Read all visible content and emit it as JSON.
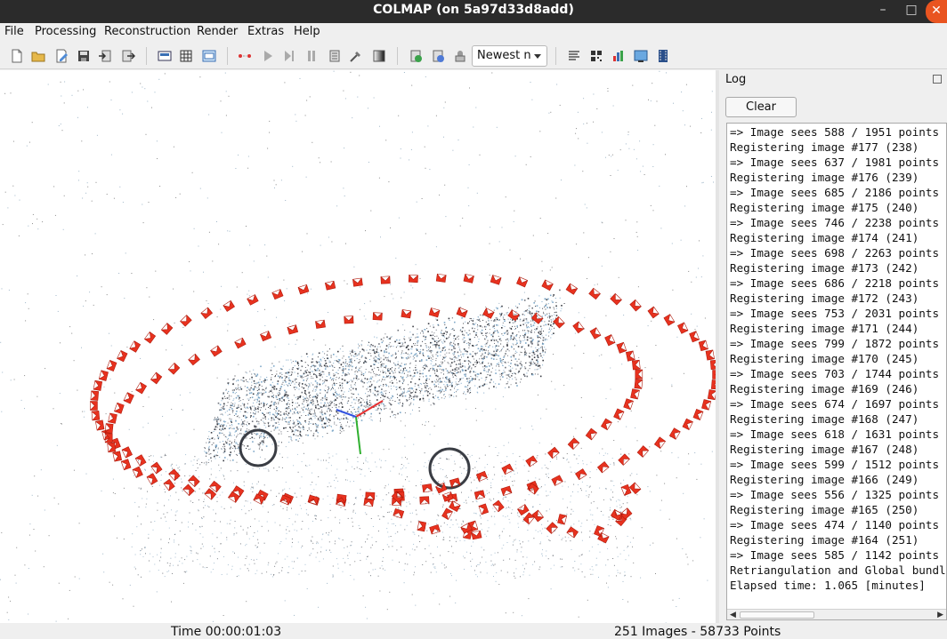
{
  "window": {
    "title": "COLMAP (on 5a97d33d8add)",
    "minimize": "–",
    "maximize": "□",
    "close": "✕"
  },
  "menu": [
    "File",
    "Processing",
    "Reconstruction",
    "Render",
    "Extras",
    "Help"
  ],
  "toolbar": {
    "icons": [
      "new-project-icon",
      "open-project-icon",
      "edit-project-icon",
      "save-project-icon",
      "import-model-icon",
      "export-model-icon",
      "feature-extraction-icon",
      "feature-matching-icon",
      "database-management-icon",
      "reconstruction-start-icon",
      "reconstruction-step-icon",
      "reconstruction-pause-icon",
      "reconstruction-normalize-icon",
      "reconstruction-options-icon",
      "bundle-adjustment-icon",
      "dense-reconstruction-icon",
      "render-toggle-icon",
      "render-reset-icon",
      "render-options-icon",
      "model-statistics-icon",
      "match-matrix-icon",
      "log-icon",
      "grab-image-icon",
      "grab-movie-icon"
    ],
    "model_select": "Newest n"
  },
  "log": {
    "title": "Log",
    "clear_label": "Clear",
    "lines": [
      "=> Image sees 588 / 1951 points",
      "Registering image #177 (238)",
      "=> Image sees 637 / 1981 points",
      "Registering image #176 (239)",
      "=> Image sees 685 / 2186 points",
      "Registering image #175 (240)",
      "=> Image sees 746 / 2238 points",
      "Registering image #174 (241)",
      "=> Image sees 698 / 2263 points",
      "Registering image #173 (242)",
      "=> Image sees 686 / 2218 points",
      "Registering image #172 (243)",
      "=> Image sees 753 / 2031 points",
      "Registering image #171 (244)",
      "=> Image sees 799 / 1872 points",
      "Registering image #170 (245)",
      "=> Image sees 703 / 1744 points",
      "Registering image #169 (246)",
      "=> Image sees 674 / 1697 points",
      "Registering image #168 (247)",
      "=> Image sees 618 / 1631 points",
      "Registering image #167 (248)",
      "=> Image sees 599 / 1512 points",
      "Registering image #166 (249)",
      "=> Image sees 556 / 1325 points",
      "Registering image #165 (250)",
      "=> Image sees 474 / 1140 points",
      "Registering image #164 (251)",
      "=> Image sees 585 / 1142 points",
      "Retriangulation and Global bundle",
      "Elapsed time: 1.065 [minutes]"
    ]
  },
  "status": {
    "time": "Time 00:00:01:03",
    "summary": "251 Images - 58733 Points"
  },
  "colors": {
    "camera": "#e8321f",
    "point_dark": "#3a3d44",
    "point_blue": "#7fa9c9",
    "axis_x": "#e83030",
    "axis_y": "#30b030",
    "axis_z": "#3050e0"
  }
}
